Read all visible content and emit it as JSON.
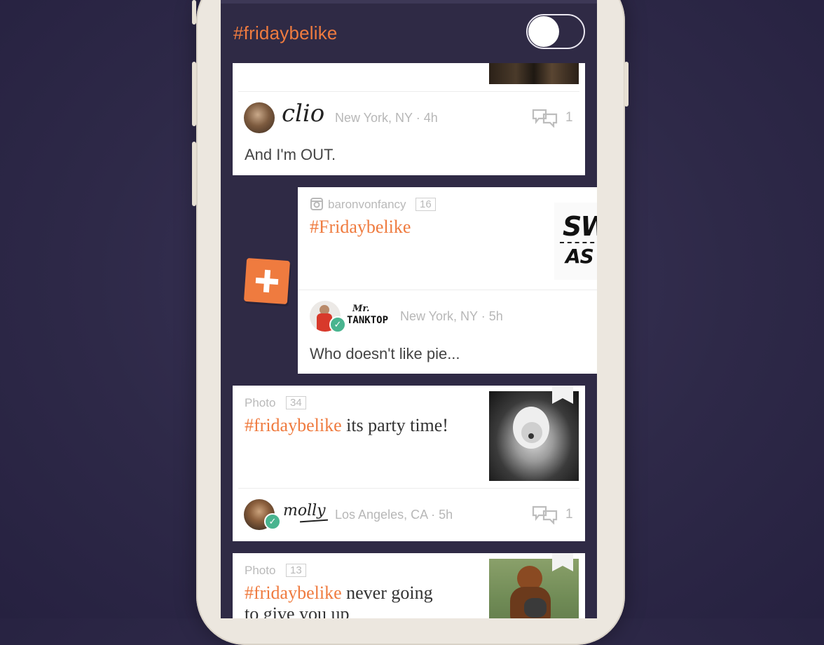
{
  "header": {
    "title": "#fridaybelike",
    "toggle_on": false
  },
  "posts": [
    {
      "author_signature": "clio",
      "location_time": "New York, NY · 4h",
      "comments": "1",
      "text": "And I'm OUT."
    },
    {
      "source_user": "baronvonfancy",
      "count": "16",
      "hashtag": "#Fridaybelike",
      "image_text_line1": "SW",
      "image_text_line2": "AS",
      "author_signature_line1": "Mr.",
      "author_signature_line2": "TANKTOP",
      "location_time": "New York, NY · 5h",
      "text": "Who doesn't like pie..."
    },
    {
      "type": "Photo",
      "count": "34",
      "hashtag": "#fridaybelike",
      "title_rest": " its party time!",
      "author_signature": "molly",
      "location_time": "Los Angeles, CA · 5h",
      "comments": "1"
    },
    {
      "type": "Photo",
      "count": "13",
      "hashtag": "#fridaybelike",
      "title_rest_line1": " never going",
      "title_line2": "to give you up"
    }
  ],
  "colors": {
    "accent": "#ef7b3f",
    "background": "#2f2a45",
    "verified": "#49b48f"
  }
}
